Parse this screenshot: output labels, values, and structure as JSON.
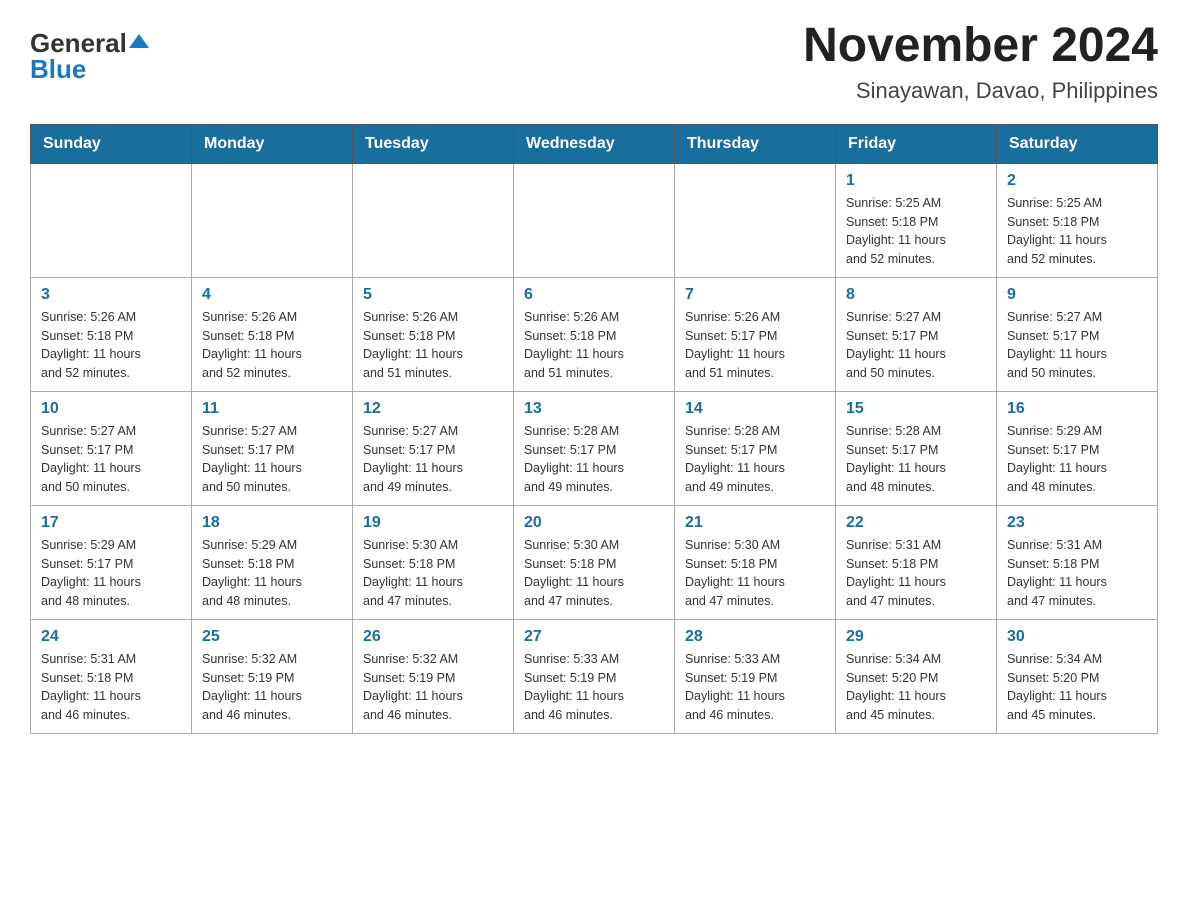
{
  "header": {
    "logo_general": "General",
    "logo_blue": "Blue",
    "month_title": "November 2024",
    "location": "Sinayawan, Davao, Philippines"
  },
  "weekdays": [
    "Sunday",
    "Monday",
    "Tuesday",
    "Wednesday",
    "Thursday",
    "Friday",
    "Saturday"
  ],
  "weeks": [
    [
      {
        "day": "",
        "info": ""
      },
      {
        "day": "",
        "info": ""
      },
      {
        "day": "",
        "info": ""
      },
      {
        "day": "",
        "info": ""
      },
      {
        "day": "",
        "info": ""
      },
      {
        "day": "1",
        "info": "Sunrise: 5:25 AM\nSunset: 5:18 PM\nDaylight: 11 hours\nand 52 minutes."
      },
      {
        "day": "2",
        "info": "Sunrise: 5:25 AM\nSunset: 5:18 PM\nDaylight: 11 hours\nand 52 minutes."
      }
    ],
    [
      {
        "day": "3",
        "info": "Sunrise: 5:26 AM\nSunset: 5:18 PM\nDaylight: 11 hours\nand 52 minutes."
      },
      {
        "day": "4",
        "info": "Sunrise: 5:26 AM\nSunset: 5:18 PM\nDaylight: 11 hours\nand 52 minutes."
      },
      {
        "day": "5",
        "info": "Sunrise: 5:26 AM\nSunset: 5:18 PM\nDaylight: 11 hours\nand 51 minutes."
      },
      {
        "day": "6",
        "info": "Sunrise: 5:26 AM\nSunset: 5:18 PM\nDaylight: 11 hours\nand 51 minutes."
      },
      {
        "day": "7",
        "info": "Sunrise: 5:26 AM\nSunset: 5:17 PM\nDaylight: 11 hours\nand 51 minutes."
      },
      {
        "day": "8",
        "info": "Sunrise: 5:27 AM\nSunset: 5:17 PM\nDaylight: 11 hours\nand 50 minutes."
      },
      {
        "day": "9",
        "info": "Sunrise: 5:27 AM\nSunset: 5:17 PM\nDaylight: 11 hours\nand 50 minutes."
      }
    ],
    [
      {
        "day": "10",
        "info": "Sunrise: 5:27 AM\nSunset: 5:17 PM\nDaylight: 11 hours\nand 50 minutes."
      },
      {
        "day": "11",
        "info": "Sunrise: 5:27 AM\nSunset: 5:17 PM\nDaylight: 11 hours\nand 50 minutes."
      },
      {
        "day": "12",
        "info": "Sunrise: 5:27 AM\nSunset: 5:17 PM\nDaylight: 11 hours\nand 49 minutes."
      },
      {
        "day": "13",
        "info": "Sunrise: 5:28 AM\nSunset: 5:17 PM\nDaylight: 11 hours\nand 49 minutes."
      },
      {
        "day": "14",
        "info": "Sunrise: 5:28 AM\nSunset: 5:17 PM\nDaylight: 11 hours\nand 49 minutes."
      },
      {
        "day": "15",
        "info": "Sunrise: 5:28 AM\nSunset: 5:17 PM\nDaylight: 11 hours\nand 48 minutes."
      },
      {
        "day": "16",
        "info": "Sunrise: 5:29 AM\nSunset: 5:17 PM\nDaylight: 11 hours\nand 48 minutes."
      }
    ],
    [
      {
        "day": "17",
        "info": "Sunrise: 5:29 AM\nSunset: 5:17 PM\nDaylight: 11 hours\nand 48 minutes."
      },
      {
        "day": "18",
        "info": "Sunrise: 5:29 AM\nSunset: 5:18 PM\nDaylight: 11 hours\nand 48 minutes."
      },
      {
        "day": "19",
        "info": "Sunrise: 5:30 AM\nSunset: 5:18 PM\nDaylight: 11 hours\nand 47 minutes."
      },
      {
        "day": "20",
        "info": "Sunrise: 5:30 AM\nSunset: 5:18 PM\nDaylight: 11 hours\nand 47 minutes."
      },
      {
        "day": "21",
        "info": "Sunrise: 5:30 AM\nSunset: 5:18 PM\nDaylight: 11 hours\nand 47 minutes."
      },
      {
        "day": "22",
        "info": "Sunrise: 5:31 AM\nSunset: 5:18 PM\nDaylight: 11 hours\nand 47 minutes."
      },
      {
        "day": "23",
        "info": "Sunrise: 5:31 AM\nSunset: 5:18 PM\nDaylight: 11 hours\nand 47 minutes."
      }
    ],
    [
      {
        "day": "24",
        "info": "Sunrise: 5:31 AM\nSunset: 5:18 PM\nDaylight: 11 hours\nand 46 minutes."
      },
      {
        "day": "25",
        "info": "Sunrise: 5:32 AM\nSunset: 5:19 PM\nDaylight: 11 hours\nand 46 minutes."
      },
      {
        "day": "26",
        "info": "Sunrise: 5:32 AM\nSunset: 5:19 PM\nDaylight: 11 hours\nand 46 minutes."
      },
      {
        "day": "27",
        "info": "Sunrise: 5:33 AM\nSunset: 5:19 PM\nDaylight: 11 hours\nand 46 minutes."
      },
      {
        "day": "28",
        "info": "Sunrise: 5:33 AM\nSunset: 5:19 PM\nDaylight: 11 hours\nand 46 minutes."
      },
      {
        "day": "29",
        "info": "Sunrise: 5:34 AM\nSunset: 5:20 PM\nDaylight: 11 hours\nand 45 minutes."
      },
      {
        "day": "30",
        "info": "Sunrise: 5:34 AM\nSunset: 5:20 PM\nDaylight: 11 hours\nand 45 minutes."
      }
    ]
  ]
}
